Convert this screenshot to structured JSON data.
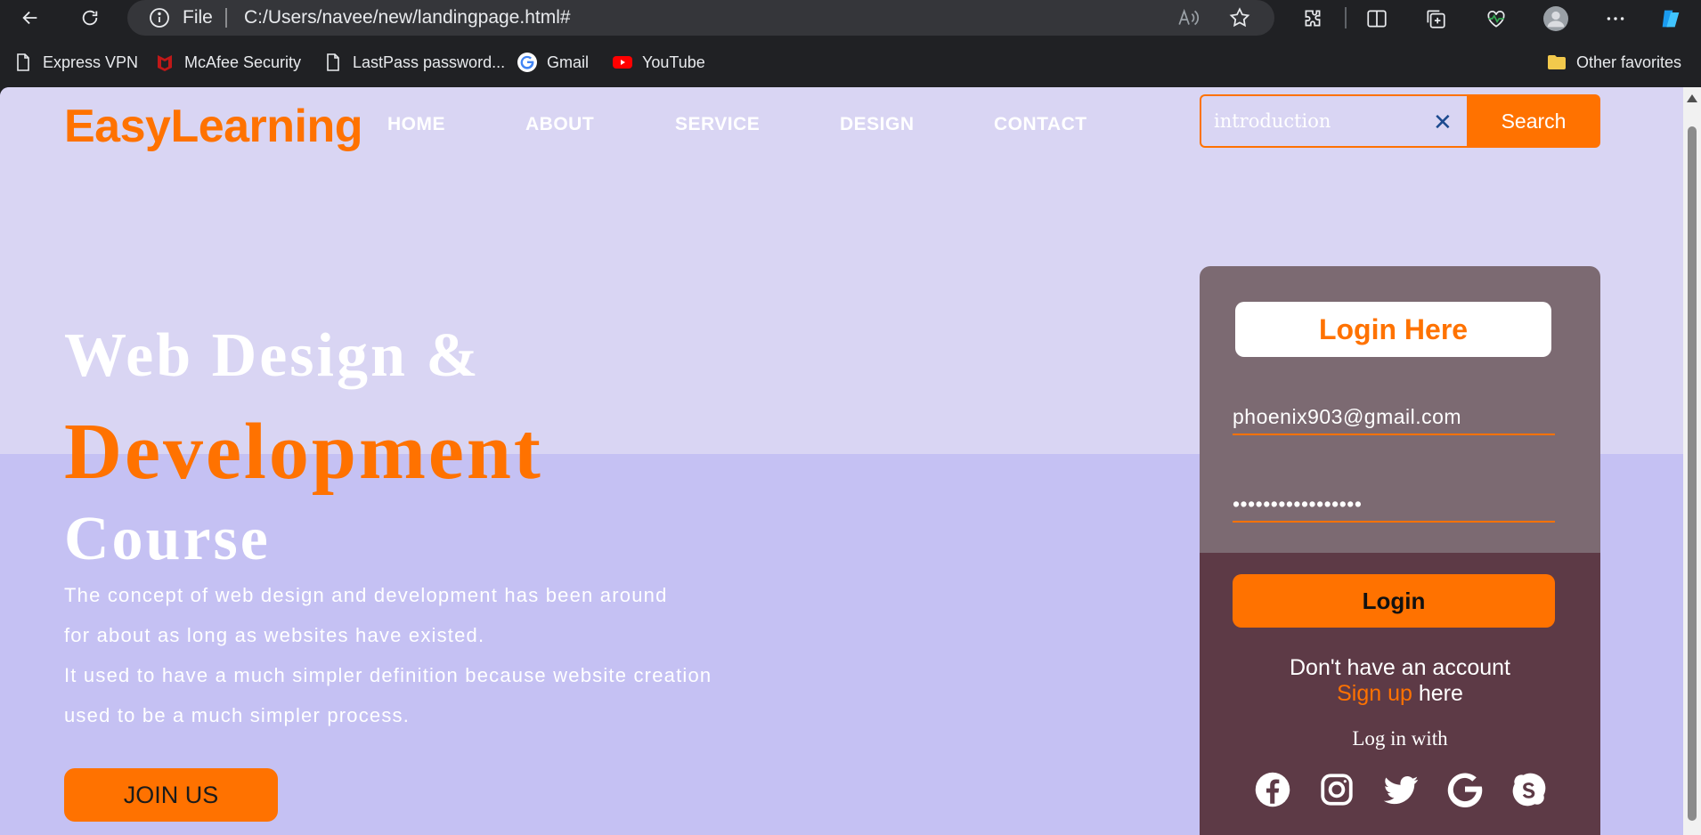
{
  "browser": {
    "file_label": "File",
    "url": "C:/Users/navee/new/landingpage.html#",
    "bookmarks": [
      {
        "label": "Express VPN",
        "icon": "page-icon"
      },
      {
        "label": "McAfee Security",
        "icon": "mcafee-icon"
      },
      {
        "label": "LastPass password...",
        "icon": "page-icon"
      },
      {
        "label": "Gmail",
        "icon": "google-icon"
      },
      {
        "label": "YouTube",
        "icon": "youtube-icon"
      }
    ],
    "other_favorites": "Other favorites"
  },
  "nav": {
    "logo": "EasyLearning",
    "menu": [
      "HOME",
      "ABOUT",
      "SERVICE",
      "DESIGN",
      "CONTACT"
    ]
  },
  "search": {
    "value": "introduction",
    "clear_symbol": "✕",
    "button": "Search"
  },
  "hero": {
    "line1": "Web Design &",
    "line2": "Development",
    "line3": "Course",
    "paragraph": [
      "The concept of web design and development has been around",
      "for about as long as websites have existed.",
      "It used to have a much simpler definition because website creation",
      "used to be a much simpler process."
    ],
    "join": "JOIN US"
  },
  "login": {
    "title": "Login Here",
    "email": "phoenix903@gmail.com",
    "password": "•••••••••••••••••",
    "button": "Login",
    "no_account": "Don't have an account",
    "signup_link": "Sign up",
    "signup_suffix": " here",
    "login_with": "Log in with",
    "socials": [
      "facebook-icon",
      "instagram-icon",
      "twitter-icon",
      "google-icon",
      "skype-icon"
    ]
  },
  "colors": {
    "accent": "#ff7200",
    "page_top": "#d9d5f3",
    "page_bottom": "#c5c1f3",
    "card_top": "#7c6a72",
    "card_bottom": "#5d3a46"
  }
}
